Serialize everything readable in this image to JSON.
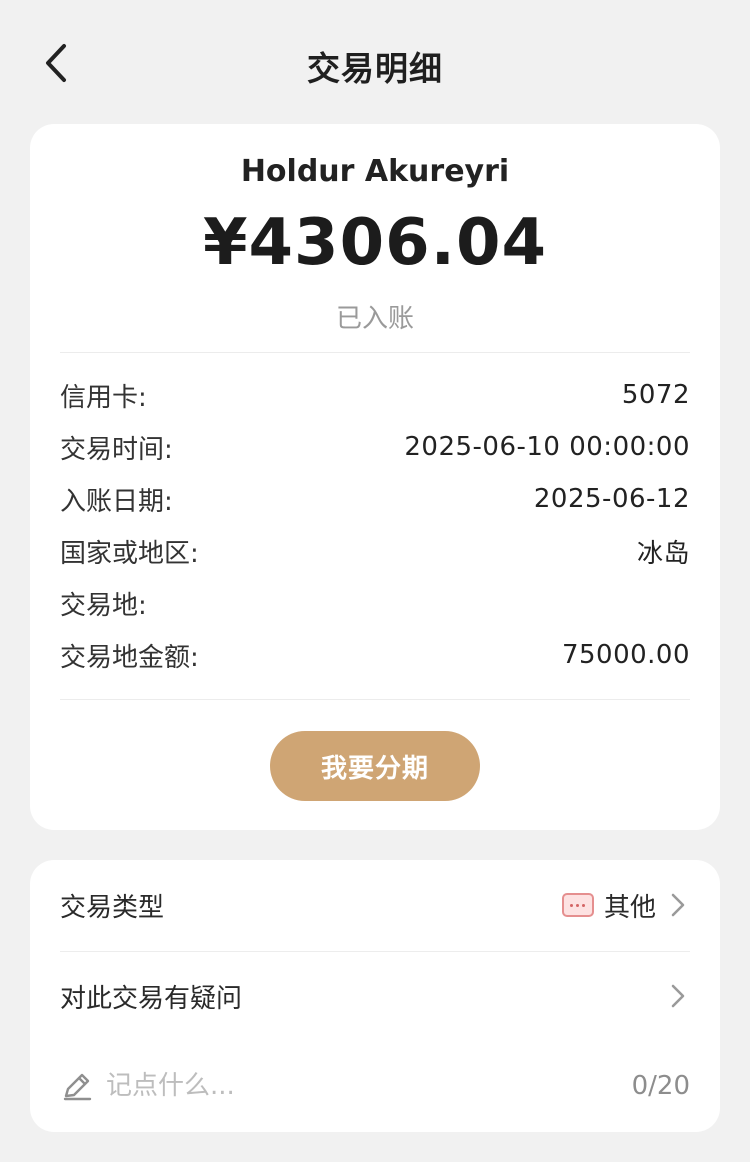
{
  "header": {
    "title": "交易明细",
    "back_icon": "chevron-left-icon"
  },
  "summary": {
    "merchant": "Holdur Akureyri",
    "amount": "¥4306.04",
    "status": "已入账"
  },
  "details": [
    {
      "label": "信用卡:",
      "value": "5072"
    },
    {
      "label": "交易时间:",
      "value": "2025-06-10 00:00:00"
    },
    {
      "label": "入账日期:",
      "value": "2025-06-12"
    },
    {
      "label": "国家或地区:",
      "value": "冰岛"
    },
    {
      "label": "交易地:",
      "value": ""
    },
    {
      "label": "交易地金额:",
      "value": "75000.00"
    }
  ],
  "installment_button": {
    "label": "我要分期",
    "color": "#cfa574"
  },
  "transaction_type": {
    "label": "交易类型",
    "value": "其他",
    "icon": "other-category-icon"
  },
  "question": {
    "label": "对此交易有疑问"
  },
  "note": {
    "placeholder": "记点什么...",
    "value": "",
    "counter": "0/20",
    "icon": "pencil-icon"
  }
}
